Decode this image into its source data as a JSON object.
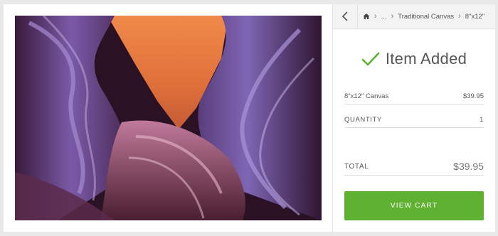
{
  "breadcrumb": {
    "items": [
      {
        "label": "..."
      },
      {
        "label": "Traditional Canvas"
      },
      {
        "label": "8\"x12\""
      }
    ]
  },
  "confirmation": {
    "message": "Item Added",
    "check_color": "#5fb131"
  },
  "order": {
    "item_name": "8\"x12\" Canvas",
    "item_price": "$39.95",
    "quantity_label": "QUANTITY",
    "quantity_value": "1",
    "total_label": "TOTAL",
    "total_value": "$39.95"
  },
  "actions": {
    "view_cart_label": "VIEW CART",
    "accent": "#5fb131"
  },
  "icons": {
    "back": "chevron-left-icon",
    "home": "home-icon",
    "separator": "chevron-right-icon",
    "confirmation": "checkmark-icon"
  }
}
